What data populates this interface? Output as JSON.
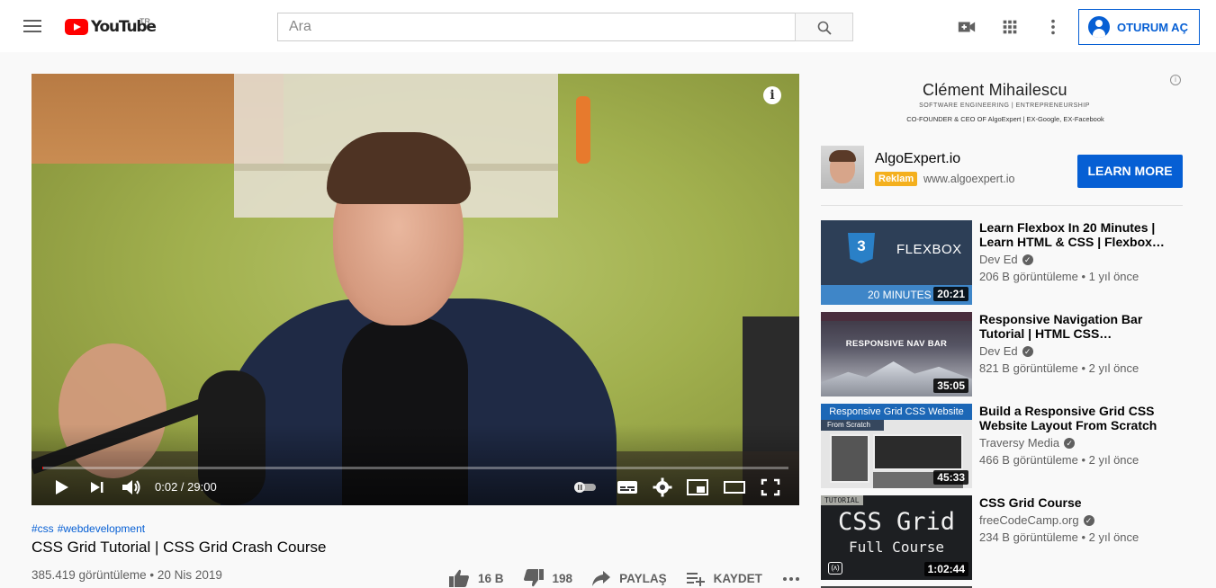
{
  "header": {
    "logo_text": "YouTube",
    "country": "TR",
    "search_placeholder": "Ara",
    "signin_label": "OTURUM AÇ"
  },
  "player": {
    "time": "0:02 / 29:00",
    "progress": 0.0011
  },
  "video": {
    "hashtags": [
      "#css",
      "#webdevelopment"
    ],
    "title": "CSS Grid Tutorial | CSS Grid Crash Course",
    "meta": "385.419 görüntüleme • 20 Nis 2019",
    "likes": "16 B",
    "dislikes": "198",
    "share_label": "PAYLAŞ",
    "save_label": "KAYDET"
  },
  "ad": {
    "banner_name": "Clément Mihailescu",
    "banner_sub": "SOFTWARE ENGINEERING | ENTREPRENEURSHIP",
    "banner_sub2": "CO-FOUNDER & CEO OF AlgoExpert | EX-Google, EX-Facebook",
    "title": "AlgoExpert.io",
    "badge": "Reklam",
    "url": "www.algoexpert.io",
    "cta": "LEARN MORE"
  },
  "recommendations": [
    {
      "title": "Learn Flexbox In 20 Minutes | Learn HTML & CSS | Flexbox…",
      "channel": "Dev Ed",
      "stats": "206 B görüntüleme • 1 yıl önce",
      "duration": "20:21",
      "thumb_text": "FLEXBOX",
      "thumb_sub": "20 MINUTES"
    },
    {
      "title": "Responsive Navigation Bar Tutorial | HTML CSS…",
      "channel": "Dev Ed",
      "stats": "821 B görüntüleme • 2 yıl önce",
      "duration": "35:05",
      "thumb_text": "RESPONSIVE NAV BAR"
    },
    {
      "title": "Build a Responsive Grid CSS Website Layout From Scratch",
      "channel": "Traversy Media",
      "stats": "466 B görüntüleme • 2 yıl önce",
      "duration": "45:33",
      "thumb_text": "Responsive Grid CSS Website",
      "thumb_sub": "From Scratch"
    },
    {
      "title": "CSS Grid Course",
      "channel": "freeCodeCamp.org",
      "stats": "234 B görüntüleme • 2 yıl önce",
      "duration": "1:02:44",
      "thumb_label": "TUTORIAL",
      "thumb_text": "CSS Grid",
      "thumb_sub": "Full Course"
    }
  ]
}
